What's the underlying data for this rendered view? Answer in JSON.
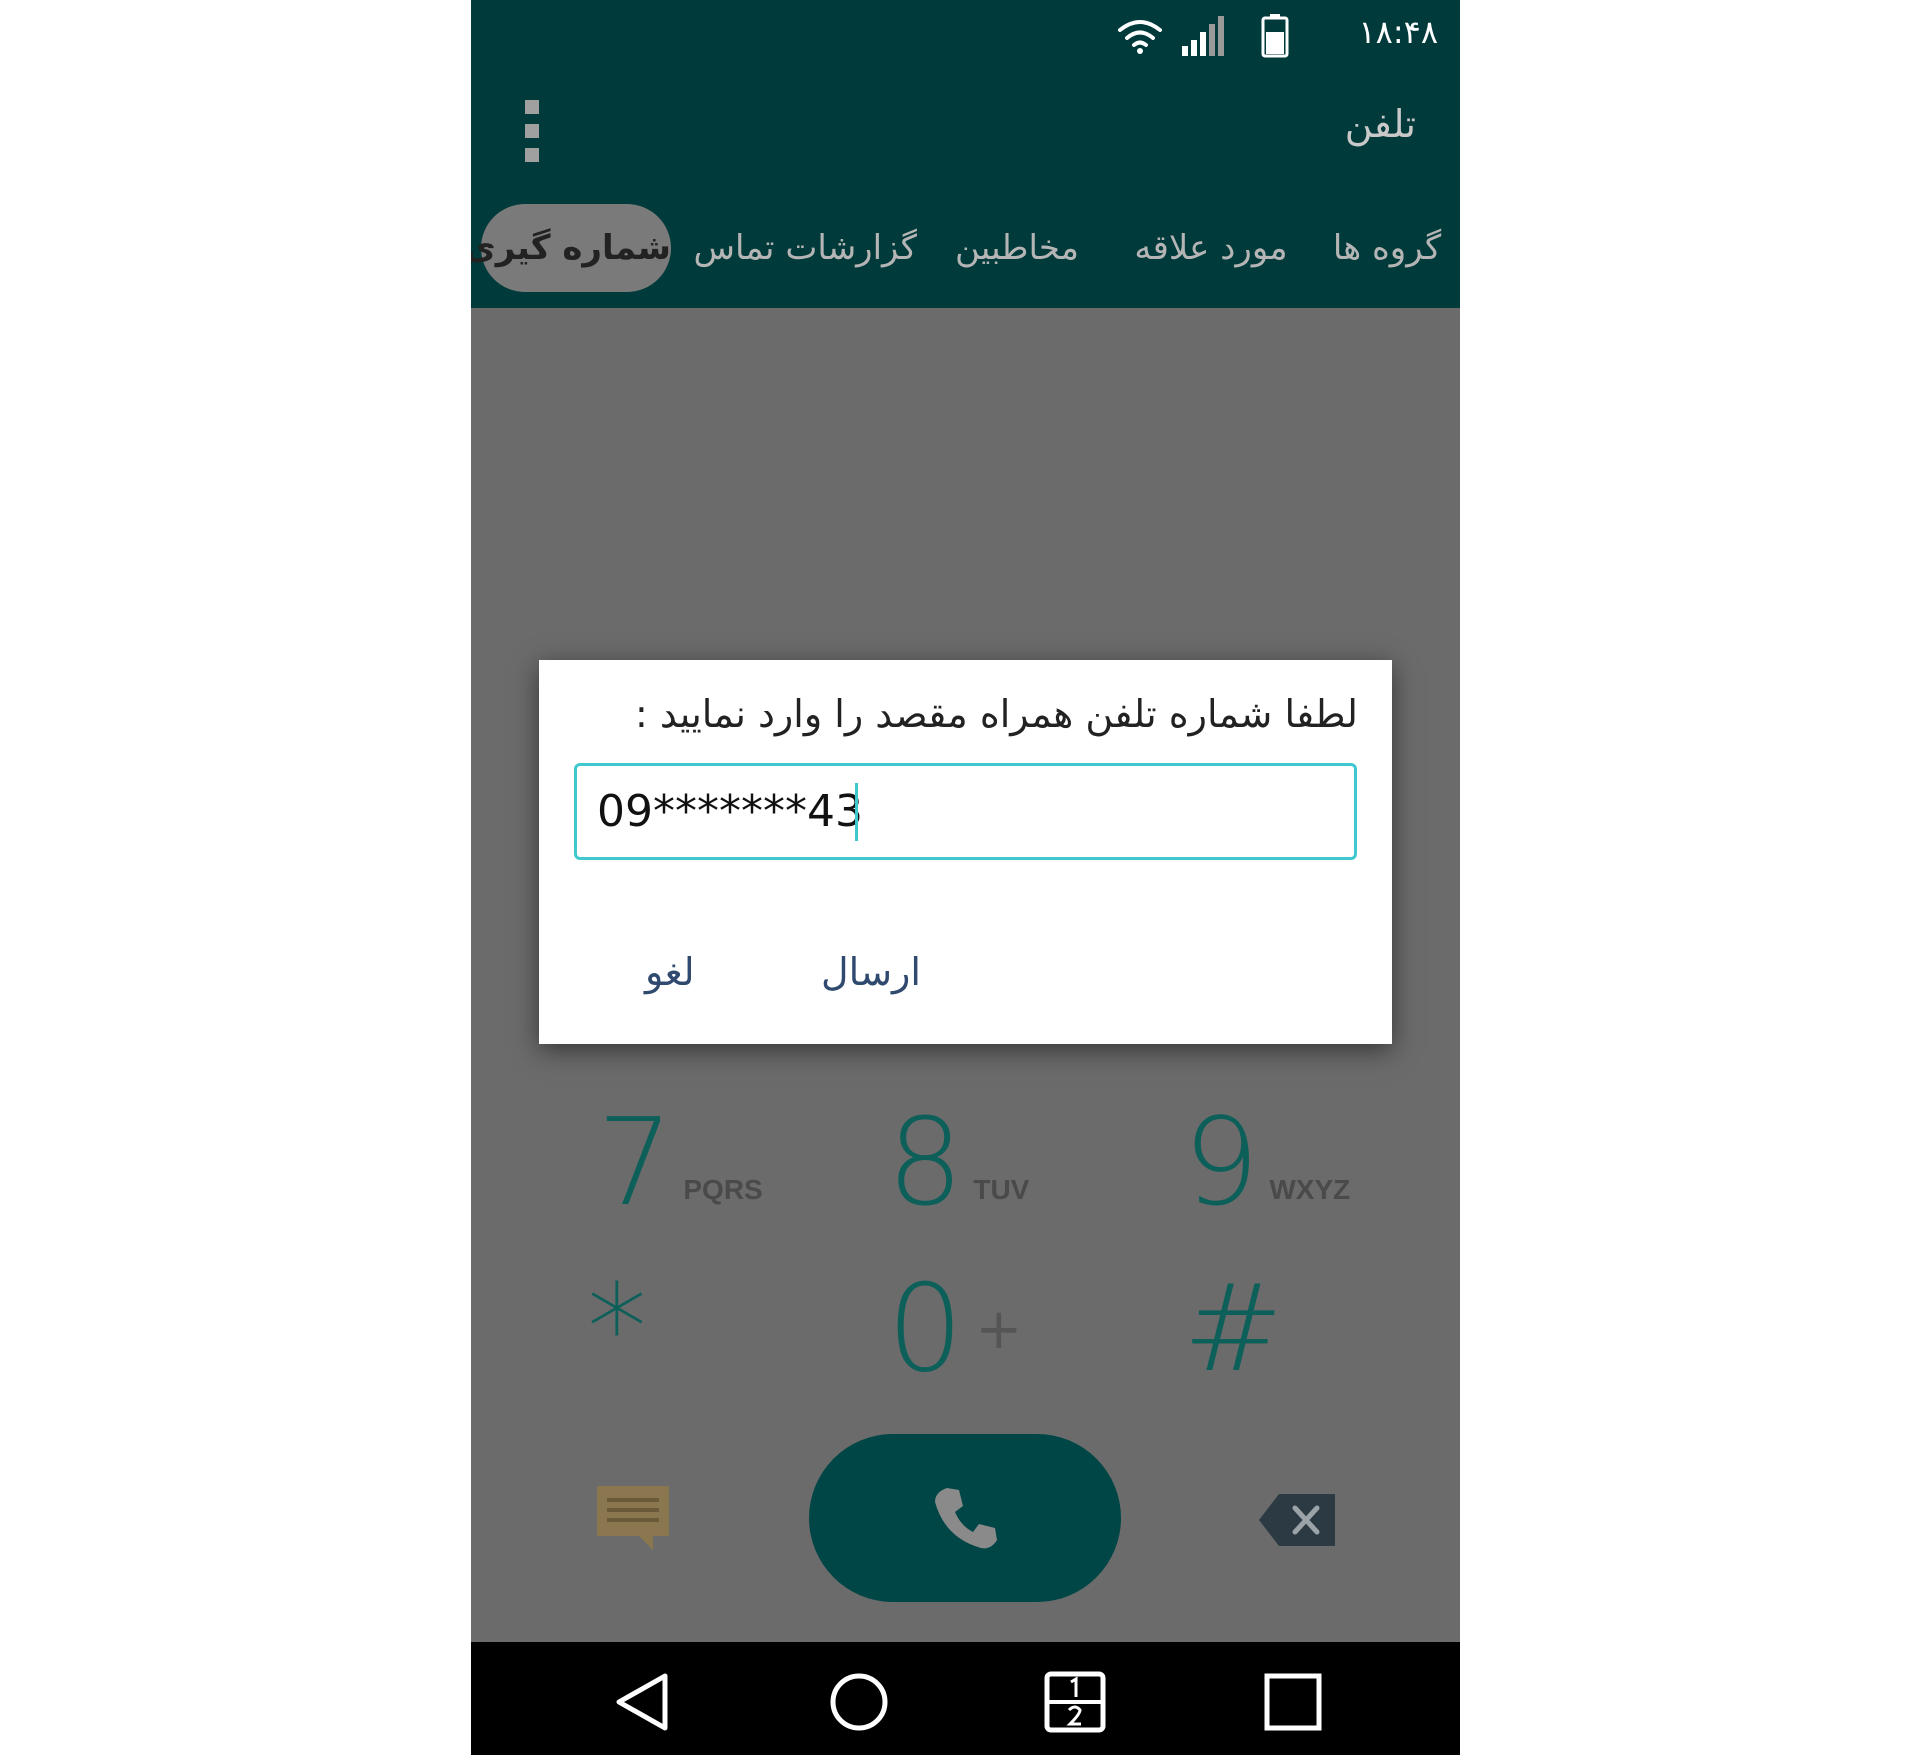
{
  "status_bar": {
    "time": "۱۸:۴۸"
  },
  "app_bar": {
    "title": "تلفن"
  },
  "tabs": [
    {
      "label": "گروه ها"
    },
    {
      "label": "مورد علاقه"
    },
    {
      "label": "مخاطبین"
    },
    {
      "label": "گزارشات تماس"
    },
    {
      "label": "شماره گیری",
      "active": true
    }
  ],
  "keypad": [
    {
      "digit": "7",
      "letters": "PQRS"
    },
    {
      "digit": "8",
      "letters": "TUV"
    },
    {
      "digit": "9",
      "letters": "WXYZ"
    },
    {
      "digit": "*",
      "letters": ""
    },
    {
      "digit": "0",
      "letters": "+"
    },
    {
      "digit": "#",
      "letters": ""
    }
  ],
  "dialog": {
    "title": "لطفا شماره تلفن همراه مقصد را وارد نمایید :",
    "input_value": "09*******43",
    "send_label": "ارسال",
    "cancel_label": "لغو"
  },
  "colors": {
    "primary_dark": "#003a3a",
    "accent": "#0d5f5a",
    "input_focus": "#3fc9cf",
    "dialog_button_text": "#2f4a6e"
  }
}
